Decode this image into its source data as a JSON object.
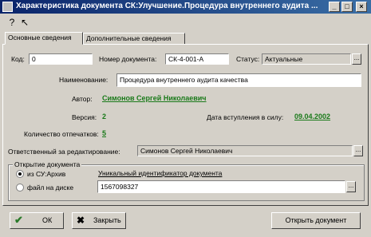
{
  "window": {
    "title": "Характеристика документа СК:Улучшение.Процедура внутреннего аудита ..."
  },
  "tabs": [
    {
      "label": "Основные сведения"
    },
    {
      "label": "Дополнительные сведения"
    }
  ],
  "form": {
    "code_label": "Код:",
    "code_value": "0",
    "doc_number_label": "Номер документа:",
    "doc_number_value": "СК-4-001-А",
    "status_label": "Статус:",
    "status_value": "Актуальные",
    "name_label": "Наименование:",
    "name_value": "Процедура внутреннего аудита качества",
    "author_label": "Автор:",
    "author_value": "Симонов Сергей Николаевич",
    "version_label": "Версия:",
    "version_value": "2",
    "effective_date_label": "Дата вступления в силу:",
    "effective_date_value": "09.04.2002",
    "copies_label": "Количество отпечатков:",
    "copies_value": "5",
    "responsible_label": "Ответственный за редактирование:",
    "responsible_value": "Симонов Сергей Николаевич"
  },
  "open_group": {
    "title": "Открытие документа",
    "option1_label": "из СУ:Архив",
    "option2_label": "файл на диске",
    "unique_id_label": "Уникальный идентификатор документа",
    "unique_id_value": "1567098327"
  },
  "buttons": {
    "ok": "ОК",
    "close": "Закрыть",
    "open_doc": "Открыть документ"
  },
  "colors": {
    "title_bar": "#0a246a",
    "link_green": "#1a7a1a"
  }
}
